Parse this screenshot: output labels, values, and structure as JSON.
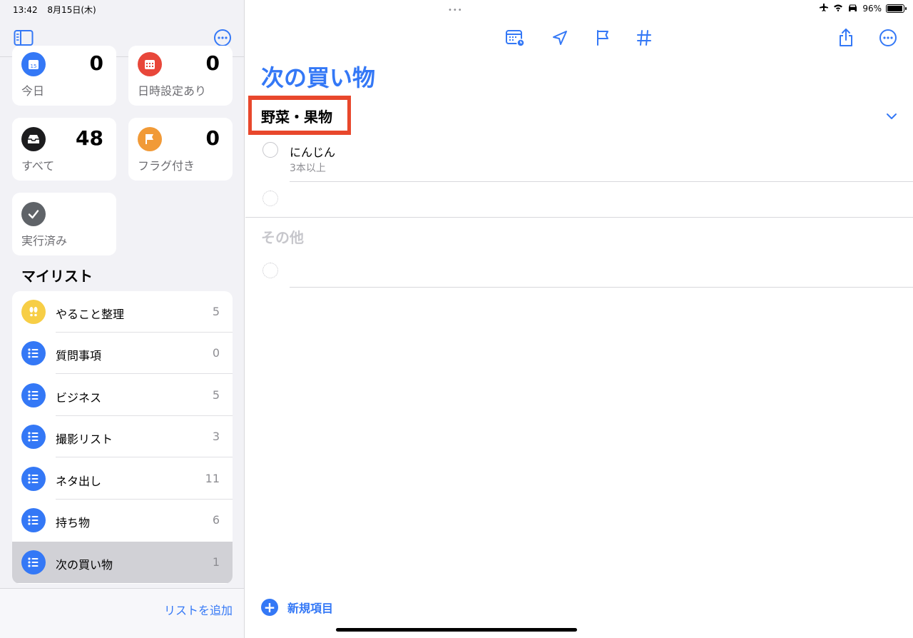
{
  "status_bar": {
    "time": "13:42",
    "date": "8月15日(木)",
    "battery": "96%",
    "battery_level": 0.96,
    "multitask": "•••"
  },
  "smart_lists": [
    {
      "label": "今日",
      "count": "0",
      "color": "#3478f6",
      "icon": "calendar-today-icon"
    },
    {
      "label": "日時設定あり",
      "count": "0",
      "color": "#e8473a",
      "icon": "calendar-icon"
    },
    {
      "label": "すべて",
      "count": "48",
      "color": "#1c1c1e",
      "icon": "tray-icon"
    },
    {
      "label": "フラグ付き",
      "count": "0",
      "color": "#f19a37",
      "icon": "flag-icon"
    },
    {
      "label": "実行済み",
      "count": "",
      "color": "#5f6368",
      "icon": "checkmark-icon"
    }
  ],
  "my_lists": {
    "title": "マイリスト",
    "items": [
      {
        "name": "やること整理",
        "count": "5",
        "color": "#f7ce46",
        "icon": "footprints-icon"
      },
      {
        "name": "質問事項",
        "count": "0",
        "color": "#3478f6",
        "icon": "list-bullet-icon"
      },
      {
        "name": "ビジネス",
        "count": "5",
        "color": "#3478f6",
        "icon": "list-bullet-icon"
      },
      {
        "name": "撮影リスト",
        "count": "3",
        "color": "#3478f6",
        "icon": "list-bullet-icon"
      },
      {
        "name": "ネタ出し",
        "count": "11",
        "color": "#3478f6",
        "icon": "list-bullet-icon"
      },
      {
        "name": "持ち物",
        "count": "6",
        "color": "#3478f6",
        "icon": "list-bullet-icon"
      },
      {
        "name": "次の買い物",
        "count": "1",
        "color": "#3478f6",
        "icon": "list-bullet-icon",
        "selected": true
      }
    ]
  },
  "sidebar_footer": {
    "add_list": "リストを追加"
  },
  "main": {
    "title": "次の買い物",
    "sections": [
      {
        "title": "野菜・果物",
        "items": [
          {
            "title": "にんじん",
            "note": "3本以上"
          }
        ]
      },
      {
        "title": "その他",
        "items": []
      }
    ],
    "new_item": "新規項目"
  },
  "colors": {
    "accent": "#3478f6",
    "highlight": "#e8472c"
  }
}
